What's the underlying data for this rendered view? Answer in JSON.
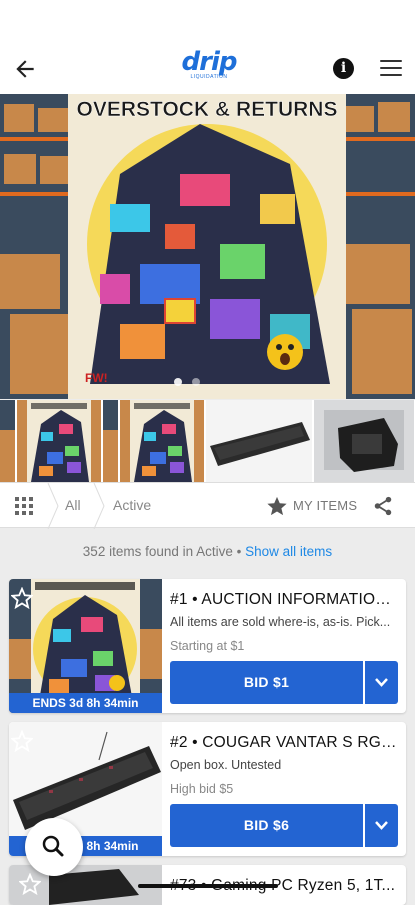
{
  "header": {
    "logo_main": "drip",
    "logo_sub": "LIQUIDATION",
    "info_label": "i"
  },
  "hero": {
    "banner_text": "OVERSTOCK & RETURNS",
    "sign_text": "FW!"
  },
  "filters": {
    "crumbs": [
      "All",
      "Active"
    ],
    "my_items_label": "MY ITEMS"
  },
  "results": {
    "count_text": "352 items found in Active •",
    "show_all_label": "Show all items"
  },
  "items": [
    {
      "title": "#1 • AUCTION INFORMATION...",
      "description": "All items are sold where-is, as-is. Pick...",
      "price_text": "Starting at $1",
      "bid_label": "BID $1",
      "ends_text": "ENDS 3d 8h 34min"
    },
    {
      "title": "#2 • COUGAR VANTAR S RGB ...",
      "description": "Open box. Untested",
      "price_text": "High bid $5",
      "bid_label": "BID $6",
      "ends_text": "ENDS 3d 8h 34min"
    },
    {
      "title": "#73 • Gaming PC Ryzen 5, 1T...",
      "description": "",
      "price_text": "",
      "bid_label": "",
      "ends_text": ""
    }
  ],
  "colors": {
    "accent": "#2364d2",
    "link": "#1e88e5",
    "logo": "#1e6fd9"
  },
  "icons": [
    "back-arrow-icon",
    "info-icon",
    "hamburger-menu-icon",
    "grid-icon",
    "star-icon",
    "share-icon",
    "chevron-down-icon",
    "search-icon"
  ]
}
